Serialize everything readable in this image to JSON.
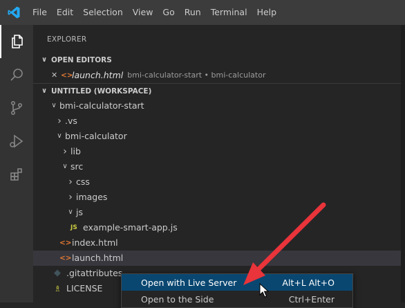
{
  "menu": [
    "File",
    "Edit",
    "Selection",
    "View",
    "Go",
    "Run",
    "Terminal",
    "Help"
  ],
  "sidebar": {
    "title": "EXPLORER",
    "open_editors": {
      "header": "OPEN EDITORS",
      "items": [
        {
          "name": "launch.html",
          "description": "bmi-calculator-start • bmi-calculator"
        }
      ]
    },
    "workspace": {
      "header": "UNTITLED (WORKSPACE)",
      "tree": [
        {
          "label": "bmi-calculator-start",
          "depth": 0,
          "expanded": true,
          "type": "folder"
        },
        {
          "label": ".vs",
          "depth": 1,
          "expanded": false,
          "type": "folder"
        },
        {
          "label": "bmi-calculator",
          "depth": 1,
          "expanded": true,
          "type": "folder"
        },
        {
          "label": "lib",
          "depth": 2,
          "expanded": false,
          "type": "folder"
        },
        {
          "label": "src",
          "depth": 2,
          "expanded": true,
          "type": "folder"
        },
        {
          "label": "css",
          "depth": 3,
          "expanded": false,
          "type": "folder"
        },
        {
          "label": "images",
          "depth": 3,
          "expanded": false,
          "type": "folder"
        },
        {
          "label": "js",
          "depth": 3,
          "expanded": true,
          "type": "folder"
        },
        {
          "label": "example-smart-app.js",
          "depth": 4,
          "type": "js"
        },
        {
          "label": "index.html",
          "depth": 2,
          "type": "html"
        },
        {
          "label": "launch.html",
          "depth": 2,
          "type": "html",
          "selected": true
        },
        {
          "label": ".gitattributes",
          "depth": 1,
          "type": "git"
        },
        {
          "label": "LICENSE",
          "depth": 1,
          "type": "license"
        }
      ]
    }
  },
  "context_menu": {
    "items": [
      {
        "label": "Open with Live Server",
        "shortcut": "Alt+L Alt+O",
        "highlighted": true
      },
      {
        "label": "Open to the Side",
        "shortcut": "Ctrl+Enter",
        "highlighted": false
      }
    ]
  },
  "icons": {
    "app_logo": "vscode-logo-icon",
    "activity": [
      "explorer-icon",
      "search-icon",
      "source-control-icon",
      "run-debug-icon",
      "extensions-icon"
    ],
    "html_glyph": "<>",
    "js_glyph": "JS"
  },
  "colors": {
    "accent_logo": "#23a9f2",
    "selection": "#094771",
    "arrow": "#e8343a",
    "html_icon": "#e37933",
    "js_icon": "#cbcb41"
  }
}
